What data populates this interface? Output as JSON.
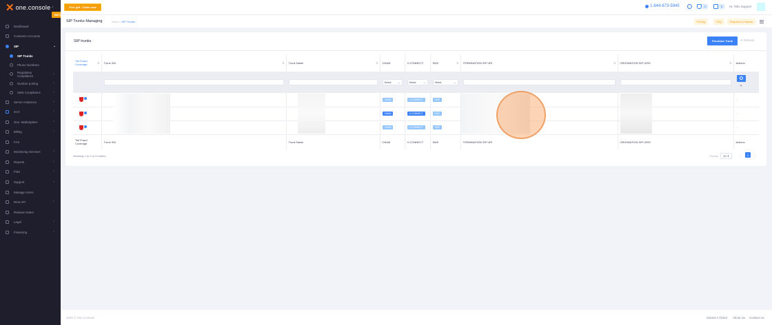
{
  "brand": {
    "logo_text": "one.console",
    "beta": "BETA"
  },
  "topbar": {
    "free_gift": "Free gift - Claim now",
    "phone": "1-844-673-5945",
    "notif_count": "0",
    "cart_count": "0",
    "user": "Hi, Tello Support"
  },
  "sidebar": {
    "items": [
      {
        "label": "Dashboard"
      },
      {
        "label": "Customer Accounts"
      },
      {
        "label": "SIP"
      },
      {
        "label": "SIP Trunks"
      },
      {
        "label": "Phone Numbers"
      },
      {
        "label": "Regulatory Compliance"
      },
      {
        "label": "Number porting"
      },
      {
        "label": "SMS Compliance"
      },
      {
        "label": "Server Instances"
      },
      {
        "label": "3CX"
      },
      {
        "label": "One. Marketplace"
      },
      {
        "label": "Billing"
      },
      {
        "label": "FAX"
      },
      {
        "label": "Monitoring Services"
      },
      {
        "label": "Reports"
      },
      {
        "label": "Files"
      },
      {
        "label": "Support"
      },
      {
        "label": "Manage Users"
      },
      {
        "label": "Rest API"
      },
      {
        "label": "Release Notes"
      },
      {
        "label": "Legal"
      },
      {
        "label": "Financing"
      }
    ]
  },
  "subheader": {
    "title": "SIP Trunks Managing",
    "crumb_home": "Home",
    "crumb_sep": "•",
    "crumb_current": "SIP Trunks",
    "pricing": "Pricing",
    "faq": "FAQ",
    "request": "Request a Feature"
  },
  "card": {
    "title": "SIP trunks",
    "purchase": "Purchase Trunk",
    "refresh": "Refresh"
  },
  "table": {
    "headers": {
      "toll": "Toll Fraud Coverage",
      "sid": "Trunk SID",
      "name": "Trunk Name",
      "cnam": "CNAM",
      "xconnect": "X-CONNECT",
      "sms": "SMS",
      "term": "TERMINATION SIP URI",
      "orig": "ORIGINATION SIP URIS",
      "actions": "Actions"
    },
    "filters": {
      "select": "Select"
    },
    "badges": {
      "cnam": "CNAM",
      "xconnect": "X-CONNECT",
      "sms": "SMS"
    },
    "row_actions": "···"
  },
  "pager": {
    "entries": "Showing 1 to 3 of 3 entries",
    "display_label": "Display",
    "page_size": "10",
    "page": "1",
    "prev": "‹",
    "next": "›"
  },
  "footer": {
    "copyright": "2025 © One.Console",
    "ticket": "Submit A Ticket",
    "about": "About Us",
    "contact": "Contact Us"
  },
  "colors": {
    "accent": "#3b82f6",
    "orange": "#f59e0b",
    "sidebar": "#1e1e2d"
  }
}
